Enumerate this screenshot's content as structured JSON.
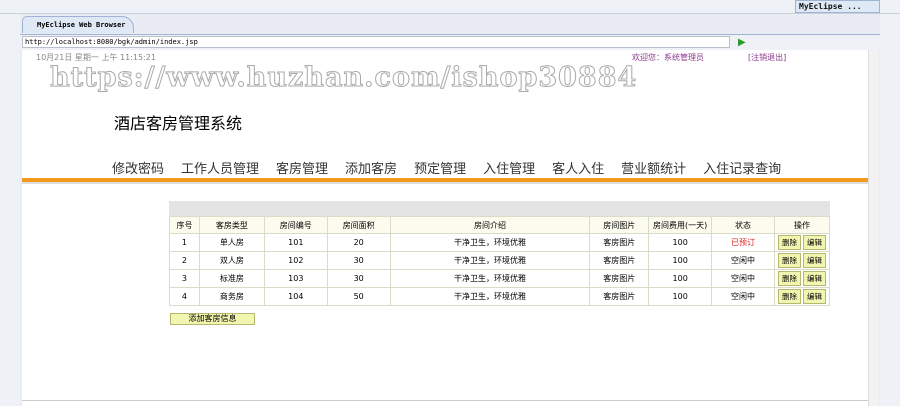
{
  "browser": {
    "perspective_label": "MyEclipse ...",
    "tab_title": "MyEclipse Web Browser",
    "url": "http://localhost:8080/bgk/admin/index.jsp"
  },
  "page": {
    "date": "10月21日 星期一 上午 11:15:21",
    "welcome": "欢迎您：系统管理员",
    "logout": "[注销退出]",
    "watermark": "https://www.huzhan.com/ishop30884",
    "title": "酒店客房管理系统",
    "nav": [
      "修改密码",
      "工作人员管理",
      "客房管理",
      "添加客房",
      "预定管理",
      "入住管理",
      "客人入住",
      "营业额统计",
      "入住记录查询"
    ],
    "table": {
      "headers": [
        "序号",
        "客房类型",
        "房间编号",
        "房间面积",
        "房间介绍",
        "房间图片",
        "房间费用(一天)",
        "状态",
        "操作"
      ],
      "rows": [
        [
          "1",
          "单人房",
          "101",
          "20",
          "干净卫生，环境优雅",
          "客房图片",
          "100",
          "已预订"
        ],
        [
          "2",
          "双人房",
          "102",
          "30",
          "干净卫生，环境优雅",
          "客房图片",
          "100",
          "空闲中"
        ],
        [
          "3",
          "标准房",
          "103",
          "30",
          "干净卫生，环境优雅",
          "客房图片",
          "100",
          "空闲中"
        ],
        [
          "4",
          "商务房",
          "104",
          "50",
          "干净卫生，环境优雅",
          "客房图片",
          "100",
          "空闲中"
        ]
      ],
      "delete_label": "删除",
      "edit_label": "编辑"
    },
    "add_button": "添加客房信息"
  },
  "colors": {
    "accent": "#f39a1e",
    "booked": "#dd2222",
    "welcome": "#8b3a8b"
  }
}
